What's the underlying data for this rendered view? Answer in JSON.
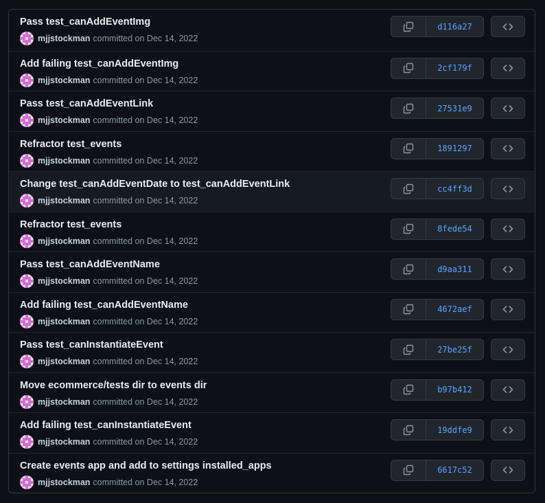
{
  "commits": [
    {
      "title": "Pass test_canAddEventImg",
      "author": "mjjstockman",
      "date_text": "committed on Dec 14, 2022",
      "sha": "d116a27"
    },
    {
      "title": "Add failing test_canAddEventImg",
      "author": "mjjstockman",
      "date_text": "committed on Dec 14, 2022",
      "sha": "2cf179f"
    },
    {
      "title": "Pass test_canAddEventLink",
      "author": "mjjstockman",
      "date_text": "committed on Dec 14, 2022",
      "sha": "27531e9"
    },
    {
      "title": "Refractor test_events",
      "author": "mjjstockman",
      "date_text": "committed on Dec 14, 2022",
      "sha": "1891297"
    },
    {
      "title": "Change test_canAddEventDate to test_canAddEventLink",
      "author": "mjjstockman",
      "date_text": "committed on Dec 14, 2022",
      "sha": "cc4ff3d"
    },
    {
      "title": "Refractor test_events",
      "author": "mjjstockman",
      "date_text": "committed on Dec 14, 2022",
      "sha": "8fede54"
    },
    {
      "title": "Pass test_canAddEventName",
      "author": "mjjstockman",
      "date_text": "committed on Dec 14, 2022",
      "sha": "d9aa311"
    },
    {
      "title": "Add failing test_canAddEventName",
      "author": "mjjstockman",
      "date_text": "committed on Dec 14, 2022",
      "sha": "4672aef"
    },
    {
      "title": "Pass test_canInstantiateEvent",
      "author": "mjjstockman",
      "date_text": "committed on Dec 14, 2022",
      "sha": "27be25f"
    },
    {
      "title": "Move ecommerce/tests dir to events dir",
      "author": "mjjstockman",
      "date_text": "committed on Dec 14, 2022",
      "sha": "b97b412"
    },
    {
      "title": "Add failing test_canInstantiateEvent",
      "author": "mjjstockman",
      "date_text": "committed on Dec 14, 2022",
      "sha": "19ddfe9"
    },
    {
      "title": "Create events app and add to settings installed_apps",
      "author": "mjjstockman",
      "date_text": "committed on Dec 14, 2022",
      "sha": "6617c52"
    }
  ],
  "highlighted_row": 4,
  "icons": {
    "copy": "copy-icon",
    "browse": "code-icon",
    "avatar": "identicon-avatar"
  },
  "colors": {
    "background": "#0d1117",
    "sha_link": "#58a6ff",
    "avatar_pink": "#d66bd6",
    "avatar_light": "#f0e6f0"
  }
}
